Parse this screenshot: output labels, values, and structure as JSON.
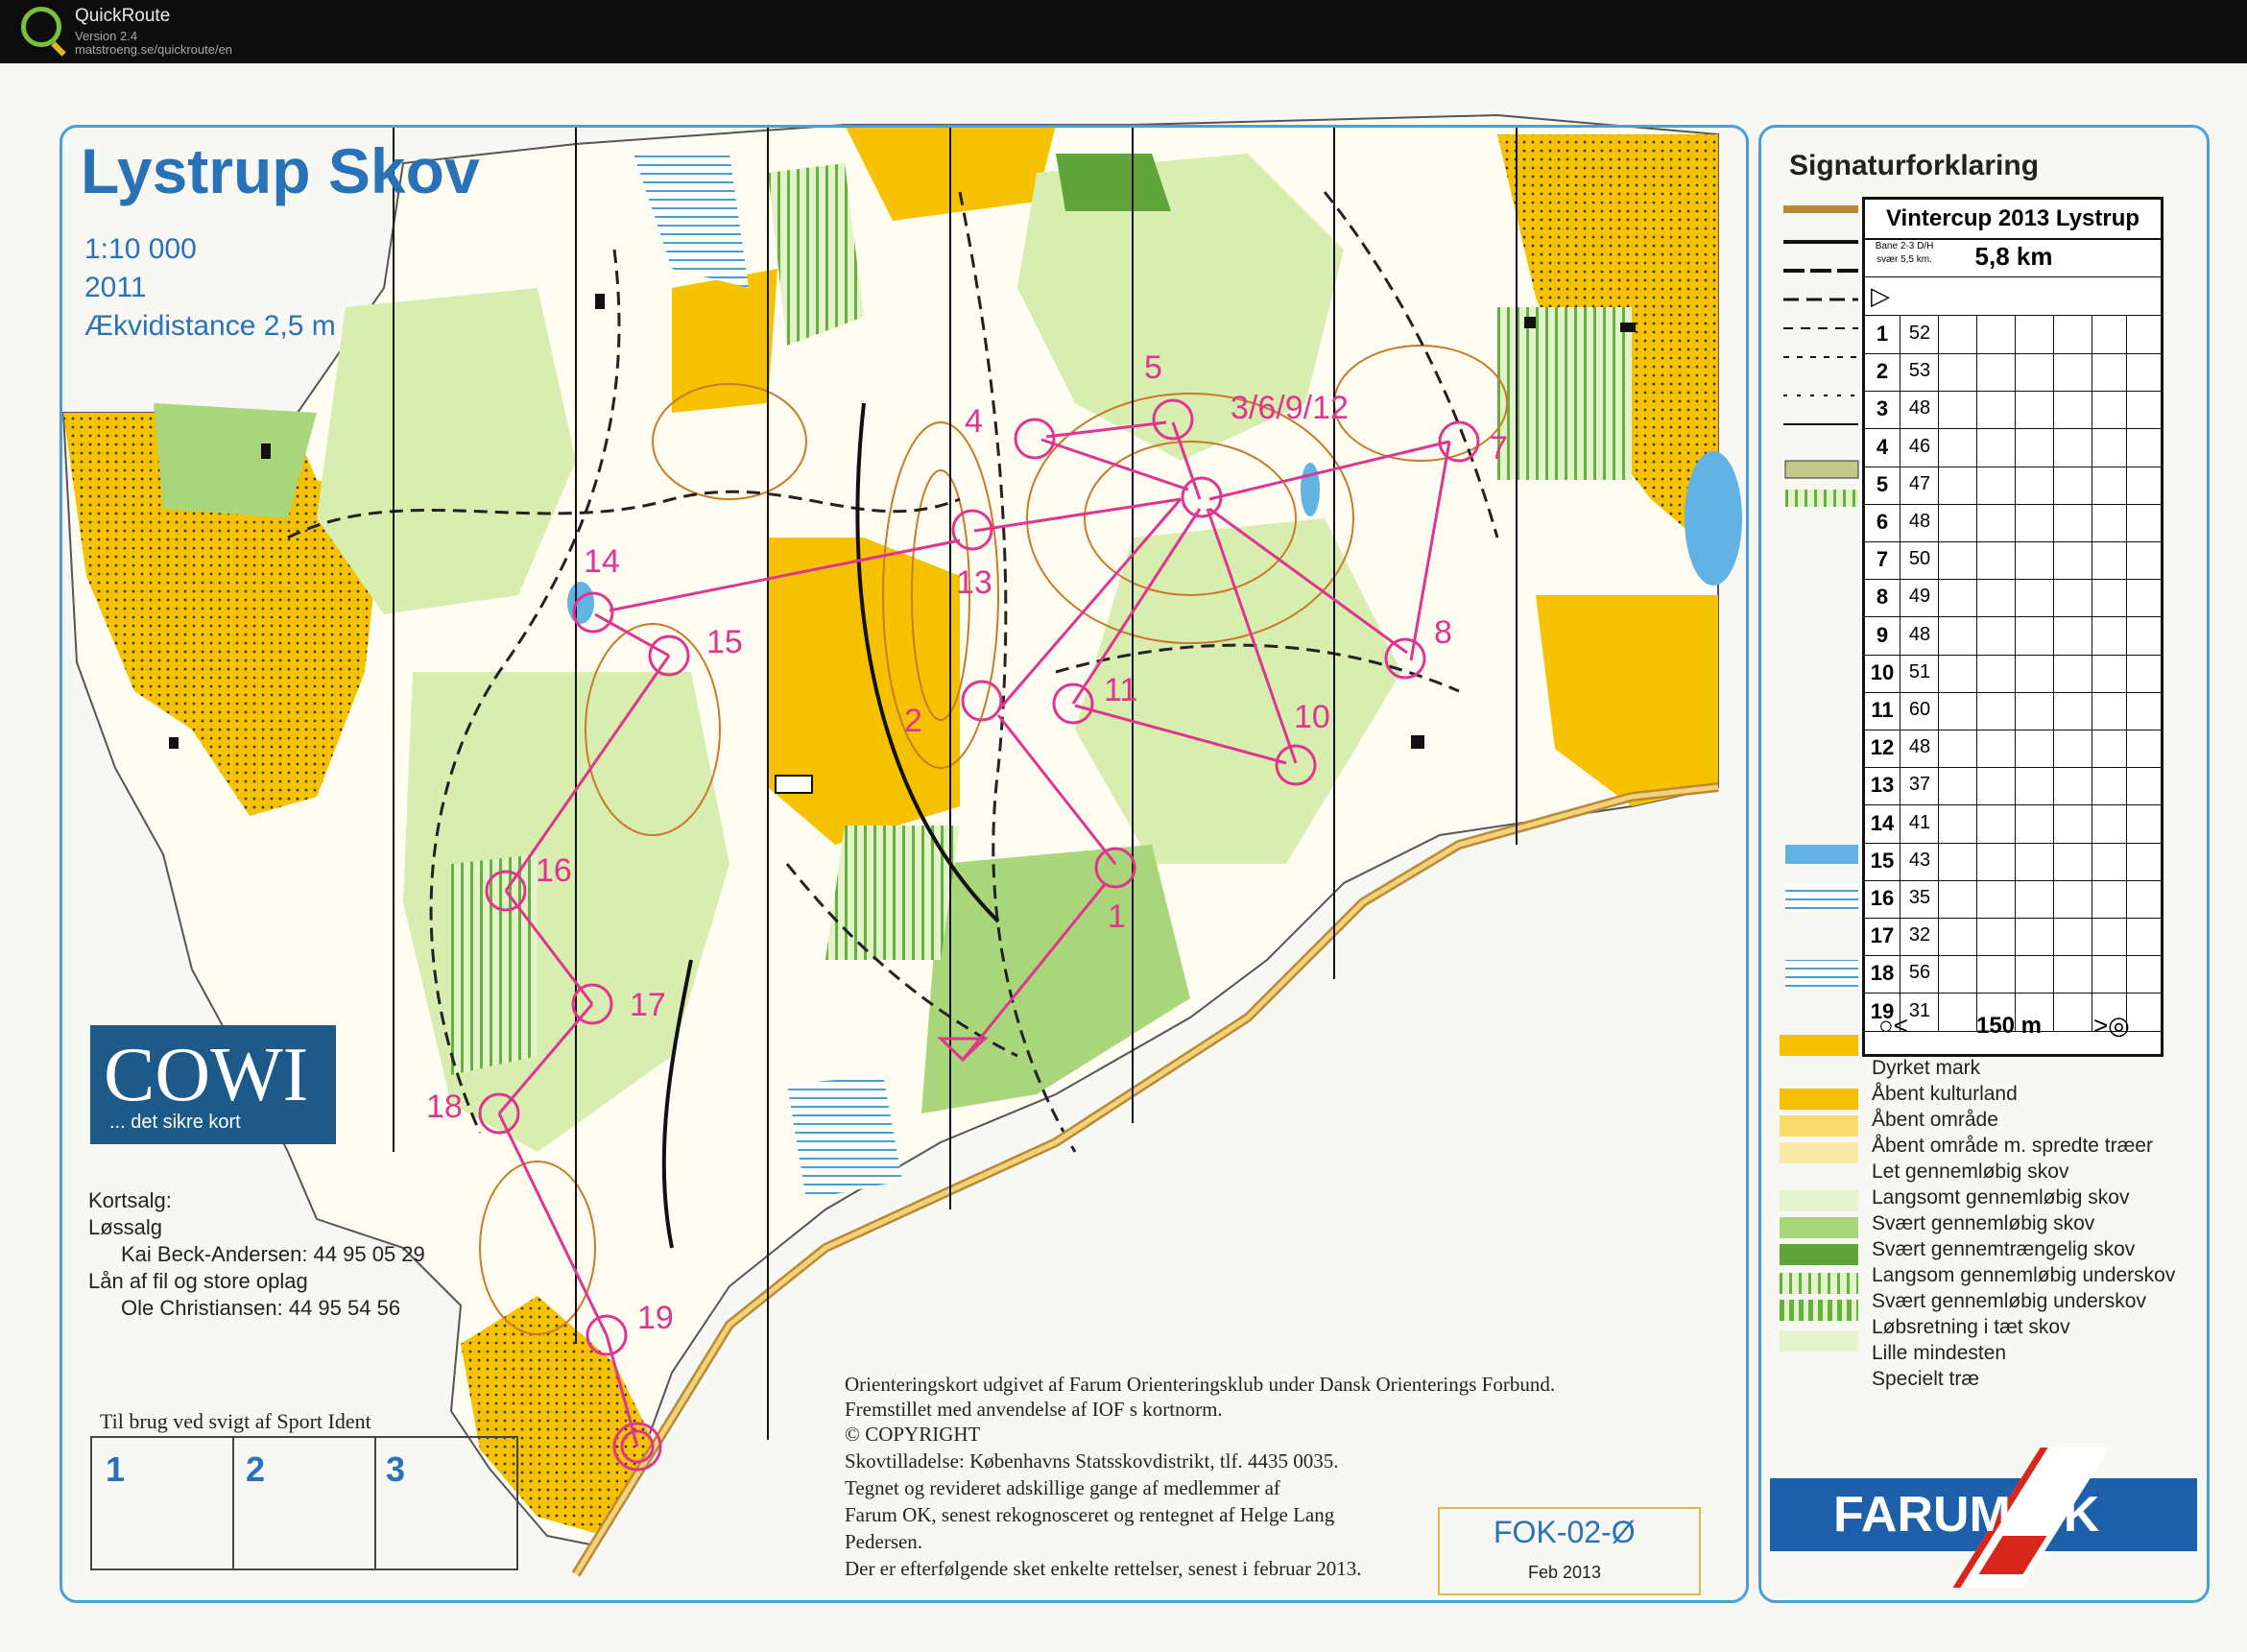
{
  "app": {
    "title": "QuickRoute",
    "version": "Version 2.4",
    "url": "matstroeng.se/quickroute/en"
  },
  "map": {
    "title": "Lystrup Skov",
    "scale": "1:10 000",
    "year": "2011",
    "contour": "Ækvidistance 2,5 m",
    "colors": {
      "open": "#f6c200",
      "forest": "#fffdf2",
      "green1": "#d8edb0",
      "green2": "#a9d67a",
      "green3": "#5fa53a",
      "course": "#e0358f",
      "water": "#4aa0d6",
      "contour": "#c87a2a"
    },
    "controls": [
      {
        "label": "1"
      },
      {
        "label": "2"
      },
      {
        "label": "3/6/9/12"
      },
      {
        "label": "4"
      },
      {
        "label": "5"
      },
      {
        "label": "7"
      },
      {
        "label": "8"
      },
      {
        "label": "10"
      },
      {
        "label": "11"
      },
      {
        "label": "13"
      },
      {
        "label": "14"
      },
      {
        "label": "15"
      },
      {
        "label": "16"
      },
      {
        "label": "17"
      },
      {
        "label": "18"
      },
      {
        "label": "19"
      }
    ]
  },
  "branding": {
    "cowi_name": "COWI",
    "cowi_tagline": "... det sikre kort"
  },
  "sales": {
    "heading": "Kortsalg:",
    "retail_label": "Løssalg",
    "retail_contact": "Kai Beck-Andersen: 44 95 05 29",
    "bulk_label": "Lån af fil og store oplag",
    "bulk_contact": "Ole Christiansen: 44 95 54 56"
  },
  "sport_ident": {
    "label": "Til brug ved svigt af Sport Ident",
    "cells": [
      "1",
      "2",
      "3"
    ]
  },
  "notes": [
    "Orienteringskort udgivet af Farum Orienteringsklub under Dansk Orienterings Forbund.",
    "Fremstillet med anvendelse af IOF s kortnorm.",
    "© COPYRIGHT",
    "Skovtilladelse: Københavns Statsskovdistrikt, tlf. 4435 0035.",
    "Tegnet og revideret adskillige gange af medlemmer af",
    "Farum OK, senest rekognosceret og rentegnet af Helge Lang",
    "Pedersen.",
    "Der er efterfølgende sket enkelte rettelser, senest i februar 2013."
  ],
  "map_code": {
    "code": "FOK-02-Ø",
    "date": "Feb 2013"
  },
  "legend": {
    "title": "Signaturforklaring",
    "items": [
      "Dyrket mark",
      "Åbent kulturland",
      "Åbent område",
      "Åbent område m. spredte træer",
      "Let gennemløbig skov",
      "Langsomt gennemløbig skov",
      "Svært gennemløbig skov",
      "Svært gennemtrængelig skov",
      "Langsom gennemløbig underskov",
      "Svært gennemløbig underskov",
      "Løbsretning i tæt skov",
      "Lille mindesten",
      "Specielt træ"
    ],
    "club": "FARUM OK"
  },
  "control_card": {
    "title": "Vintercup 2013 Lystrup",
    "course": "Bane 2-3 D/H svær 5,5 km.",
    "length": "5,8 km",
    "finish_distance": "150 m",
    "rows": [
      {
        "no": "1",
        "code": "52"
      },
      {
        "no": "2",
        "code": "53"
      },
      {
        "no": "3",
        "code": "48"
      },
      {
        "no": "4",
        "code": "46"
      },
      {
        "no": "5",
        "code": "47"
      },
      {
        "no": "6",
        "code": "48"
      },
      {
        "no": "7",
        "code": "50"
      },
      {
        "no": "8",
        "code": "49"
      },
      {
        "no": "9",
        "code": "48"
      },
      {
        "no": "10",
        "code": "51"
      },
      {
        "no": "11",
        "code": "60"
      },
      {
        "no": "12",
        "code": "48"
      },
      {
        "no": "13",
        "code": "37"
      },
      {
        "no": "14",
        "code": "41"
      },
      {
        "no": "15",
        "code": "43"
      },
      {
        "no": "16",
        "code": "35"
      },
      {
        "no": "17",
        "code": "32"
      },
      {
        "no": "18",
        "code": "56"
      },
      {
        "no": "19",
        "code": "31"
      }
    ]
  }
}
